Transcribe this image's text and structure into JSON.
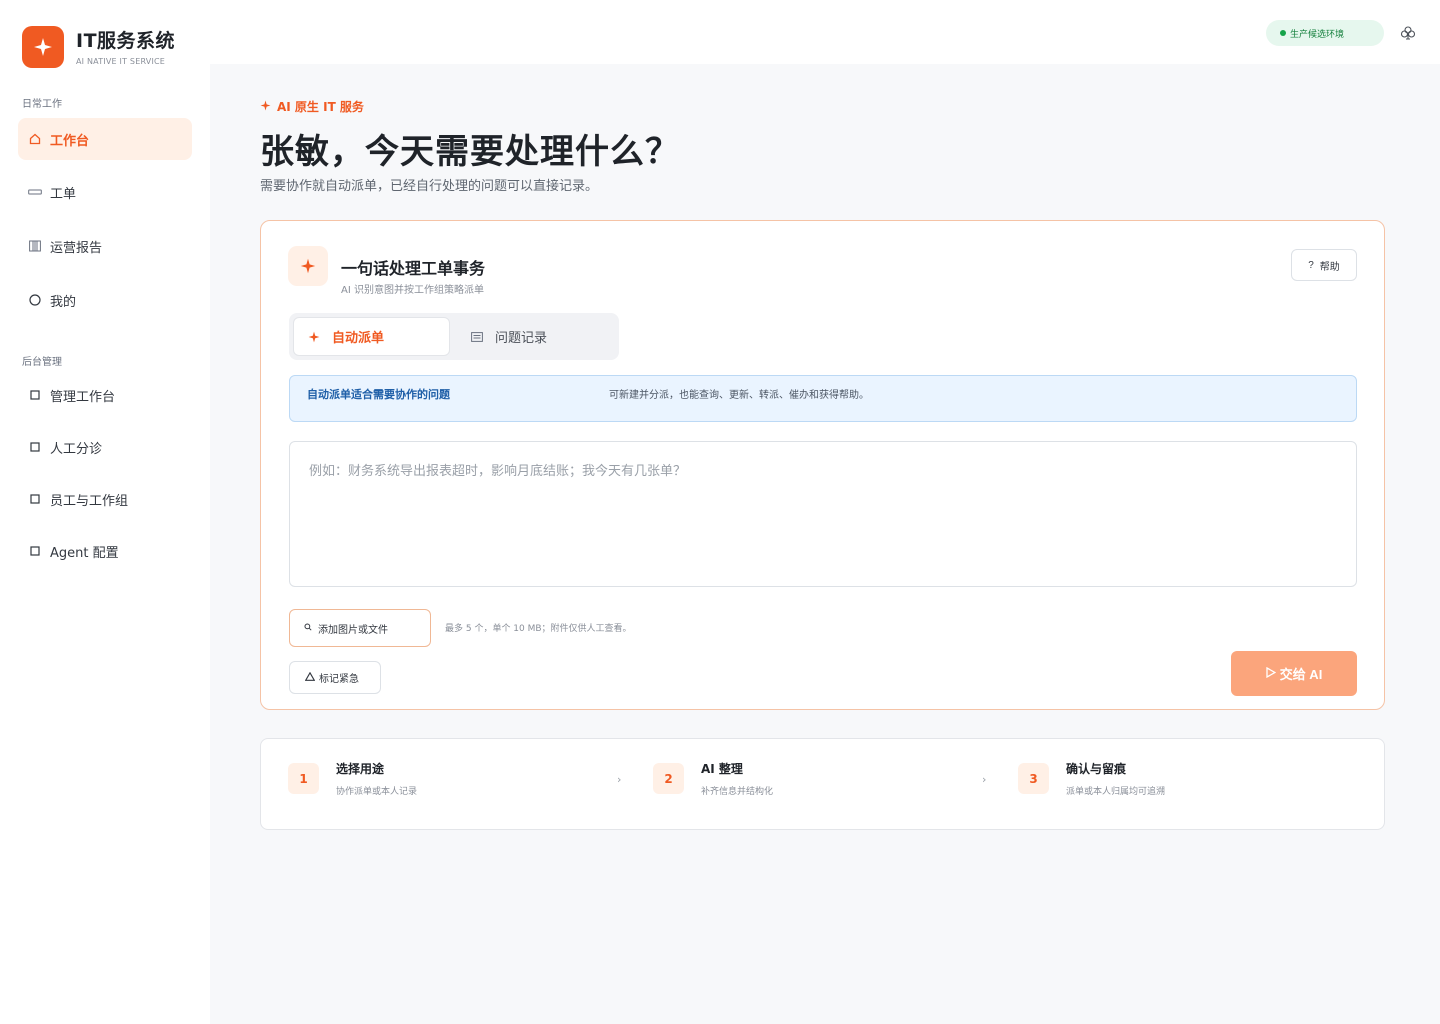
{
  "brand": {
    "title": "IT服务系统",
    "subtitle": "AI NATIVE IT SERVICE",
    "logo_icon": "sparkle-icon",
    "color": "#f05a22"
  },
  "sidebar": {
    "section_daily": "日常工作",
    "section_admin": "后台管理",
    "daily_items": [
      {
        "label": "工作台",
        "icon": "home-icon",
        "active": true
      },
      {
        "label": "工单",
        "icon": "ticket-icon"
      },
      {
        "label": "运营报告",
        "icon": "report-icon"
      },
      {
        "label": "我的",
        "icon": "user-circle-icon"
      }
    ],
    "admin_items": [
      {
        "label": "管理工作台",
        "icon": "square-icon"
      },
      {
        "label": "人工分诊",
        "icon": "square-icon"
      },
      {
        "label": "员工与工作组",
        "icon": "square-icon"
      },
      {
        "label": "Agent 配置",
        "icon": "square-icon"
      }
    ]
  },
  "topbar": {
    "env_label": "生产候选环境",
    "env_color": "#16a34a",
    "settings_icon": "club-icon"
  },
  "hero": {
    "eyebrow": "AI 原生 IT 服务",
    "title": "张敏，今天需要处理什么？",
    "subtitle": "需要协作就自动派单，已经自行处理的问题可以直接记录。"
  },
  "card": {
    "title": "一句话处理工单事务",
    "subtitle": "AI 识别意图并按工作组策略派单",
    "help_label": "帮助",
    "help_icon": "question-icon",
    "tabs": [
      {
        "label": "自动派单",
        "icon": "sparkle-icon",
        "active": true
      },
      {
        "label": "问题记录",
        "icon": "list-icon",
        "active": false
      }
    ],
    "info_title": "自动派单适合需要协作的问题",
    "info_desc": "可新建并分派，也能查询、更新、转派、催办和获得帮助。",
    "input_placeholder": "例如：财务系统导出报表超时，影响月底结账；我今天有几张单？",
    "input_value": "",
    "attach_label": "添加图片或文件",
    "attach_hint": "最多 5 个，单个 10 MB；附件仅供人工查看。",
    "urgent_label": "标记紧急",
    "submit_label": "交给 AI",
    "submit_color": "#fba57c"
  },
  "steps": [
    {
      "num": "1",
      "title": "选择用途",
      "desc": "协作派单或本人记录"
    },
    {
      "num": "2",
      "title": "AI 整理",
      "desc": "补齐信息并结构化"
    },
    {
      "num": "3",
      "title": "确认与留痕",
      "desc": "派单或本人归属均可追溯"
    }
  ],
  "step_arrow": "›"
}
